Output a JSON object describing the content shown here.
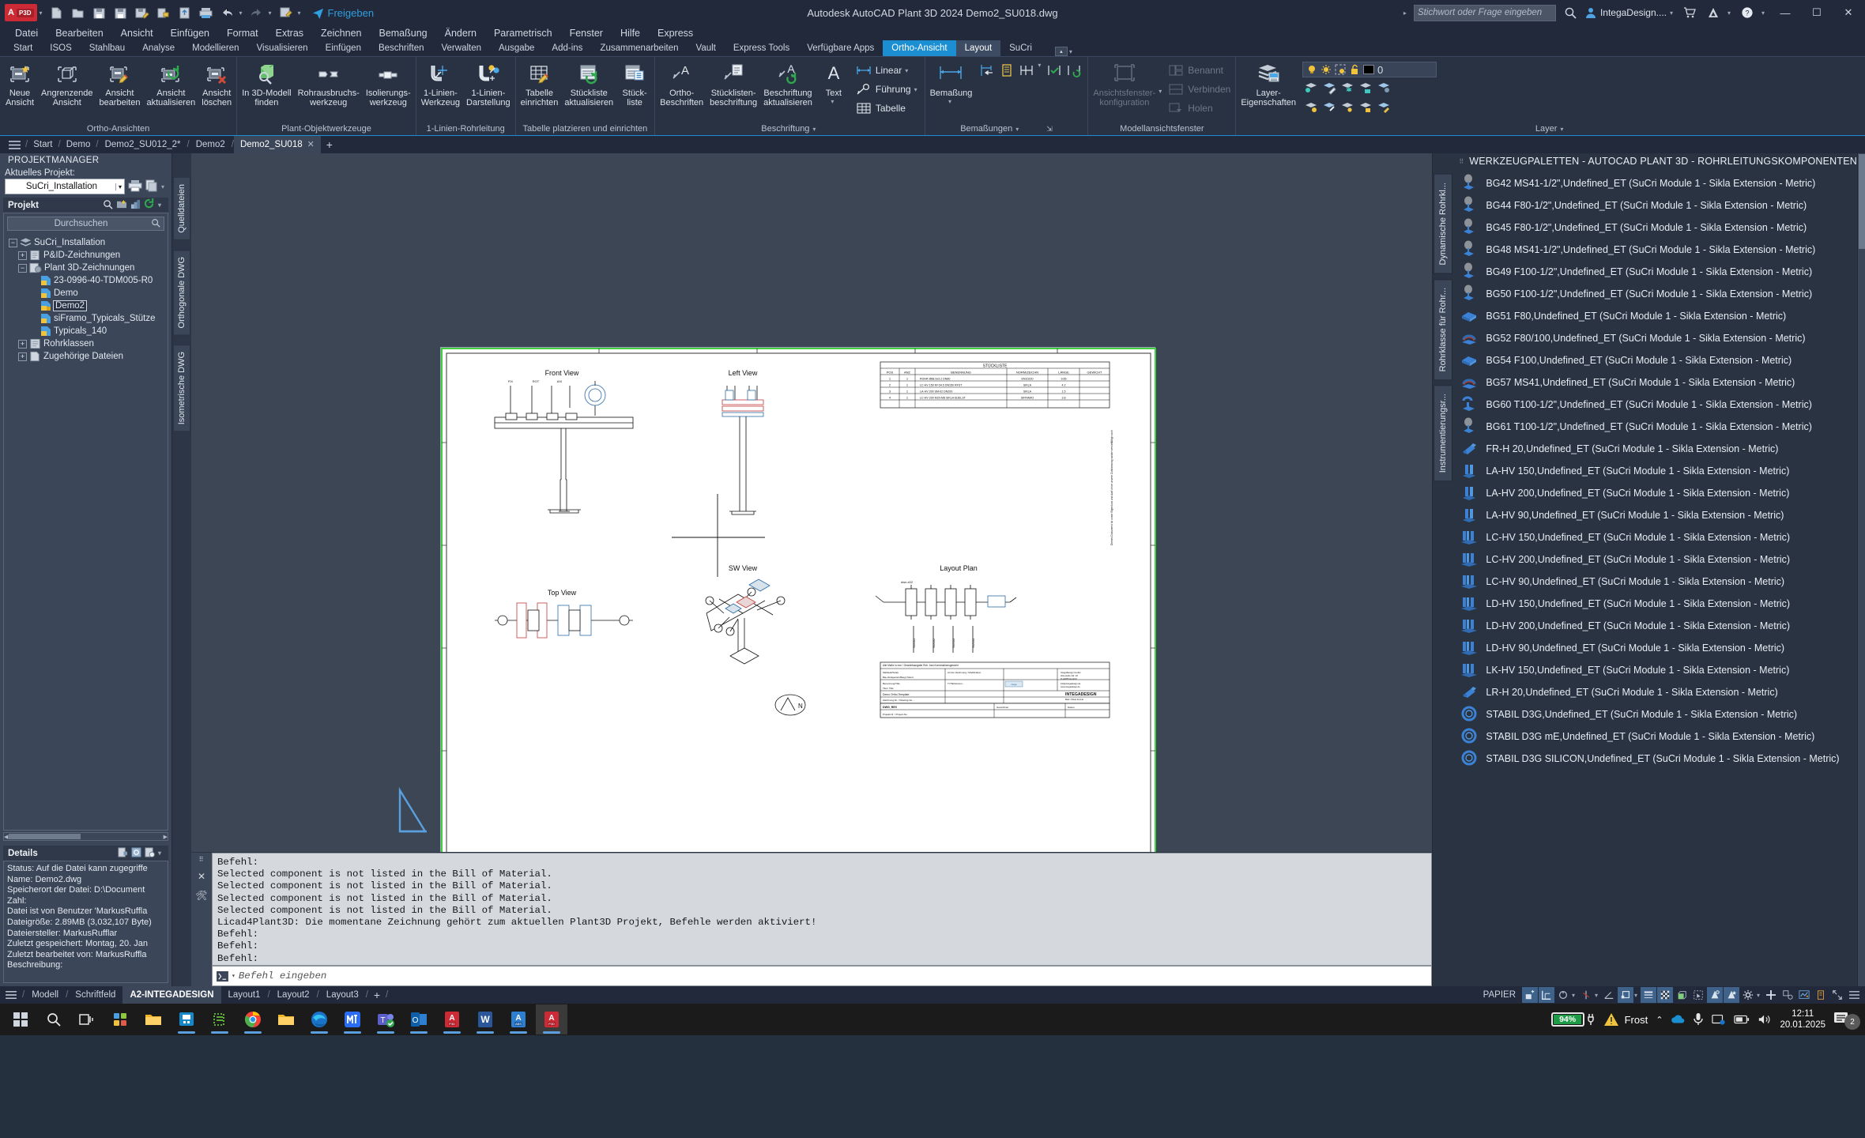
{
  "titlebar": {
    "app_name": "A",
    "app_badge": "P3D",
    "share_label": "Freigeben",
    "document_title": "Autodesk AutoCAD Plant 3D 2024    Demo2_SU018.dwg",
    "search_placeholder": "Stichwort oder Frage eingeben",
    "account_name": "IntegaDesign....",
    "quick_access": [
      "new-icon",
      "open-icon",
      "save-icon",
      "saveas-icon",
      "saveas-edit-icon",
      "export-icon",
      "share-cloud-icon",
      "plot-icon",
      "undo-icon",
      "redo-icon",
      "batch-plot-icon"
    ],
    "window_buttons": [
      "minimize",
      "restore",
      "close"
    ]
  },
  "menubar": {
    "items": [
      "Datei",
      "Bearbeiten",
      "Ansicht",
      "Einfügen",
      "Format",
      "Extras",
      "Zeichnen",
      "Bemaßung",
      "Ändern",
      "Parametrisch",
      "Fenster",
      "Hilfe",
      "Express"
    ]
  },
  "ribbon_tabs": {
    "items": [
      "Start",
      "ISOS",
      "Stahlbau",
      "Analyse",
      "Modellieren",
      "Visualisieren",
      "Einfügen",
      "Beschriften",
      "Verwalten",
      "Ausgabe",
      "Add-ins",
      "Zusammenarbeiten",
      "Vault",
      "Express Tools",
      "Verfügbare Apps",
      "Ortho-Ansicht",
      "Layout",
      "SuCri"
    ],
    "active": "Ortho-Ansicht",
    "active_secondary": "Layout"
  },
  "ribbon": {
    "panels": [
      {
        "title": "Ortho-Ansichten",
        "buttons": [
          {
            "label1": "Neue",
            "label2": "Ansicht",
            "icon": "new-view-icon"
          },
          {
            "label1": "Angrenzende",
            "label2": "Ansicht",
            "icon": "adjacent-view-icon"
          },
          {
            "label1": "Ansicht",
            "label2": "bearbeiten",
            "icon": "edit-view-icon"
          },
          {
            "label1": "Ansicht",
            "label2": "aktualisieren",
            "icon": "update-view-icon"
          },
          {
            "label1": "Ansicht",
            "label2": "löschen",
            "icon": "delete-view-icon"
          }
        ]
      },
      {
        "title": "Plant-Objektwerkzeuge",
        "buttons": [
          {
            "label1": "In 3D-Modell",
            "label2": "finden",
            "icon": "find-in-3d-icon"
          },
          {
            "label1": "Rohrausbruchs-",
            "label2": "werkzeug",
            "icon": "pipe-break-icon"
          },
          {
            "label1": "Isolierungs-",
            "label2": "werkzeug",
            "icon": "insulation-icon"
          }
        ]
      },
      {
        "title": "1-Linien-Rohrleitung",
        "buttons": [
          {
            "label1": "1-Linien-",
            "label2": "Werkzeug",
            "icon": "single-line-tool-icon"
          },
          {
            "label1": "1-Linien-",
            "label2": "Darstellung",
            "icon": "single-line-display-icon"
          }
        ]
      },
      {
        "title": "Tabelle platzieren und einrichten",
        "buttons": [
          {
            "label1": "Tabelle",
            "label2": "einrichten",
            "icon": "table-setup-icon"
          },
          {
            "label1": "Stückliste",
            "label2": "aktualisieren",
            "icon": "bom-update-icon"
          },
          {
            "label1": "Stück-",
            "label2": "liste",
            "icon": "bom-icon"
          }
        ]
      },
      {
        "title": "Beschriftung",
        "buttons": [
          {
            "label1": "Ortho-",
            "label2": "Beschriften",
            "icon": "ortho-annotate-icon"
          },
          {
            "label1": "Stücklisten-",
            "label2": "beschriftung",
            "icon": "bom-annotate-icon"
          },
          {
            "label1": "Beschriftung",
            "label2": "aktualisieren",
            "icon": "annotate-update-icon"
          },
          {
            "label1": "Text",
            "label2": "",
            "icon": "text-icon"
          }
        ],
        "small_buttons": [
          "Linear",
          "Führung",
          "Tabelle"
        ]
      },
      {
        "title": "Bemaßungen",
        "buttons": [
          {
            "label1": "Bemaßung",
            "label2": "",
            "icon": "dimension-icon"
          }
        ],
        "tools": [
          "dim-baseline-icon",
          "dim-continue-icon",
          "dim-space-icon",
          "dim-check-icon",
          "dim-update-icon"
        ]
      },
      {
        "title": "Modellansichtsfenster",
        "buttons": [
          {
            "label1": "Ansichtsfenster-",
            "label2": "konfiguration",
            "icon": "viewport-config-icon",
            "dim": true
          }
        ],
        "small_buttons": [
          {
            "label": "Benannt",
            "icon": "named-viewport-icon",
            "dim": true
          },
          {
            "label": "Verbinden",
            "icon": "join-viewport-icon",
            "dim": true
          },
          {
            "label": "Holen",
            "icon": "restore-viewport-icon",
            "dim": true
          }
        ]
      },
      {
        "title": "Layer",
        "buttons": [
          {
            "label1": "Layer-",
            "label2": "Eigenschaften",
            "icon": "layer-properties-icon"
          }
        ],
        "layer_state": {
          "value": "0",
          "color": "#000000",
          "icons": [
            "bulb-icon",
            "sun-icon",
            "freeze-icon",
            "unlock-icon"
          ]
        },
        "actions": [
          "Abgleichen",
          "Layer"
        ]
      }
    ]
  },
  "filetabs": {
    "breadcrumbs": [
      "Start",
      "Demo"
    ],
    "tabs": [
      {
        "label": "Demo2_SU012_2*",
        "active": false
      },
      {
        "label": "Demo2",
        "active": false
      },
      {
        "label": "Demo2_SU018",
        "active": true,
        "closable": true
      }
    ],
    "add_label": "+"
  },
  "project_manager": {
    "header": "PROJEKTMANAGER",
    "current_project_label": "Aktuelles Projekt:",
    "current_project": "SuCri_Installation",
    "section_title": "Projekt",
    "search_placeholder": "Durchsuchen",
    "tree": [
      {
        "label": "SuCri_Installation",
        "depth": 0,
        "expander": "-",
        "icon": "project-icon"
      },
      {
        "label": "P&ID-Zeichnungen",
        "depth": 1,
        "expander": "+",
        "icon": "pid-folder-icon"
      },
      {
        "label": "Plant 3D-Zeichnungen",
        "depth": 1,
        "expander": "-",
        "icon": "plant3d-folder-icon"
      },
      {
        "label": "23-0996-40-TDM005-R0",
        "depth": 2,
        "expander": "",
        "icon": "dwg-icon"
      },
      {
        "label": "Demo",
        "depth": 2,
        "expander": "",
        "icon": "dwg-icon"
      },
      {
        "label": "Demo2",
        "depth": 2,
        "expander": "",
        "icon": "dwg-lock-icon",
        "selected": true
      },
      {
        "label": "siFramo_Typicals_Stütze",
        "depth": 2,
        "expander": "",
        "icon": "dwg-icon"
      },
      {
        "label": "Typicals_140",
        "depth": 2,
        "expander": "",
        "icon": "dwg-icon"
      },
      {
        "label": "Rohrklassen",
        "depth": 1,
        "expander": "+",
        "icon": "specs-icon"
      },
      {
        "label": "Zugehörige Dateien",
        "depth": 1,
        "expander": "+",
        "icon": "files-icon"
      }
    ],
    "vertical_tabs": [
      "Quelldateien",
      "Orthogonale DWG",
      "Isometrische DWG"
    ],
    "details": {
      "title": "Details",
      "lines": [
        "Status: Auf die Datei kann zugegriffe",
        "Name:  Demo2.dwg",
        "Speicherort der Datei:  D:\\Document",
        "Zahl:",
        "Datei ist von Benutzer 'MarkusRuffla",
        "Dateigröße: 2.89MB (3,032,107 Byte)",
        "Dateiersteller:  MarkusRufflar",
        "Zuletzt gespeichert: Montag, 20. Jan",
        "Zuletzt bearbeitet von: MarkusRuffla",
        "Beschreibung:"
      ]
    }
  },
  "drawing": {
    "views": [
      {
        "label": "Front View"
      },
      {
        "label": "Left View"
      },
      {
        "label": "Top View"
      },
      {
        "label": "SW View"
      },
      {
        "label": "Layout Plan"
      }
    ],
    "bom_title": "STÜCKLISTE",
    "bom_headers": [
      "POS",
      "ANZ",
      "BENENNUNG",
      "NORM/ZEICHN",
      "LÄNGE",
      "GEWICHT"
    ],
    "bom_rows": [
      [
        "1",
        "1",
        "ROHR Ø88.9x3.2  DN80",
        "EN10220",
        "9.65",
        ""
      ],
      [
        "2",
        "1",
        "LC-HV 150  M=34.5 DN150 RFST",
        "SIKLA",
        "4.2",
        ""
      ],
      [
        "3",
        "1",
        "LA-HV 200  SM-02 DN200",
        "SIKLA",
        "1.5",
        ""
      ],
      [
        "4",
        "1",
        "LC-HV 200  M20-M8 SIKLA EDELSTAHL",
        "SIFRAMO",
        "3.8",
        ""
      ]
    ],
    "north_label": "N",
    "title_block": {
      "company": "INTEGADESIGN",
      "project": "Demo Ortho-Template"
    }
  },
  "commandline": {
    "history": [
      "Befehl:",
      "Selected component is not listed in the Bill of Material.",
      "Selected component is not listed in the Bill of Material.",
      "Selected component is not listed in the Bill of Material.",
      "Selected component is not listed in the Bill of Material.",
      "Licad4Plant3D: Die momentane Zeichnung gehört zum aktuellen Plant3D Projekt, Befehle werden aktiviert!",
      "Befehl:",
      "Befehl:",
      "Befehl:"
    ],
    "input_placeholder": "Befehl eingeben"
  },
  "palette": {
    "title": "WERKZEUGPALETTEN - AUTOCAD PLANT 3D - ROHRLEITUNGSKOMPONENTEN",
    "vertical_tabs": [
      "Dynamische Rohrkl...",
      "Rohrklasse für Rohr...",
      "Instrumentierungsr..."
    ],
    "items": [
      {
        "label": "BG42 MS41-1/2\",Undefined_ET (SuCri Module 1 - Sikla Extension - Metric)",
        "icon": "clamp-icon"
      },
      {
        "label": "BG44 F80-1/2\",Undefined_ET (SuCri Module 1 - Sikla Extension - Metric)",
        "icon": "clamp-icon"
      },
      {
        "label": "BG45 F80-1/2\",Undefined_ET (SuCri Module 1 - Sikla Extension - Metric)",
        "icon": "clamp-icon"
      },
      {
        "label": "BG48 MS41-1/2\",Undefined_ET (SuCri Module 1 - Sikla Extension - Metric)",
        "icon": "clamp-icon"
      },
      {
        "label": "BG49 F100-1/2\",Undefined_ET (SuCri Module 1 - Sikla Extension - Metric)",
        "icon": "clamp-icon"
      },
      {
        "label": "BG50 F100-1/2\",Undefined_ET (SuCri Module 1 - Sikla Extension - Metric)",
        "icon": "clamp-icon"
      },
      {
        "label": "BG51 F80,Undefined_ET (SuCri Module 1 - Sikla Extension - Metric)",
        "icon": "plate-icon"
      },
      {
        "label": "BG52 F80/100,Undefined_ET (SuCri Module 1 - Sikla Extension - Metric)",
        "icon": "saddle-icon"
      },
      {
        "label": "BG54 F100,Undefined_ET (SuCri Module 1 - Sikla Extension - Metric)",
        "icon": "plate-icon"
      },
      {
        "label": "BG57 MS41,Undefined_ET (SuCri Module 1 - Sikla Extension - Metric)",
        "icon": "saddle-icon"
      },
      {
        "label": "BG60 T100-1/2\",Undefined_ET (SuCri Module 1 - Sikla Extension - Metric)",
        "icon": "tee-clamp-icon"
      },
      {
        "label": "BG61 T100-1/2\",Undefined_ET (SuCri Module 1 - Sikla Extension - Metric)",
        "icon": "clamp-icon"
      },
      {
        "label": "FR-H 20,Undefined_ET (SuCri Module 1 - Sikla Extension - Metric)",
        "icon": "bracket-icon"
      },
      {
        "label": "LA-HV 150,Undefined_ET (SuCri Module 1 - Sikla Extension - Metric)",
        "icon": "support-icon"
      },
      {
        "label": "LA-HV 200,Undefined_ET (SuCri Module 1 - Sikla Extension - Metric)",
        "icon": "support-icon"
      },
      {
        "label": "LA-HV 90,Undefined_ET (SuCri Module 1 - Sikla Extension - Metric)",
        "icon": "support-icon"
      },
      {
        "label": "LC-HV 150,Undefined_ET (SuCri Module 1 - Sikla Extension - Metric)",
        "icon": "double-support-icon"
      },
      {
        "label": "LC-HV 200,Undefined_ET (SuCri Module 1 - Sikla Extension - Metric)",
        "icon": "double-support-icon"
      },
      {
        "label": "LC-HV 90,Undefined_ET (SuCri Module 1 - Sikla Extension - Metric)",
        "icon": "double-support-icon"
      },
      {
        "label": "LD-HV 150,Undefined_ET (SuCri Module 1 - Sikla Extension - Metric)",
        "icon": "double-support-icon"
      },
      {
        "label": "LD-HV 200,Undefined_ET (SuCri Module 1 - Sikla Extension - Metric)",
        "icon": "double-support-icon"
      },
      {
        "label": "LD-HV 90,Undefined_ET (SuCri Module 1 - Sikla Extension - Metric)",
        "icon": "double-support-icon"
      },
      {
        "label": "LK-HV 150,Undefined_ET (SuCri Module 1 - Sikla Extension - Metric)",
        "icon": "double-support-icon"
      },
      {
        "label": "LR-H 20,Undefined_ET (SuCri Module 1 - Sikla Extension - Metric)",
        "icon": "bracket-icon"
      },
      {
        "label": "STABIL D3G,Undefined_ET (SuCri Module 1 - Sikla Extension - Metric)",
        "icon": "ring-icon"
      },
      {
        "label": "STABIL D3G mE,Undefined_ET (SuCri Module 1 - Sikla Extension - Metric)",
        "icon": "ring-icon"
      },
      {
        "label": "STABIL D3G SILICON,Undefined_ET (SuCri Module 1 - Sikla Extension - Metric)",
        "icon": "ring-icon"
      }
    ]
  },
  "statusbar": {
    "layout_tabs": [
      "Modell",
      "Schriftfeld",
      "A2-INTEGADESIGN",
      "Layout1",
      "Layout2",
      "Layout3"
    ],
    "active_layout": "A2-INTEGADESIGN",
    "add_label": "+",
    "space_label": "PAPIER"
  },
  "taskbar": {
    "apps": [
      "start-icon",
      "search-icon",
      "taskview-icon",
      "widgets-icon",
      "explorer-icon",
      "licad-icon",
      "cad-green-icon",
      "chrome-icon",
      "folder-icon",
      "edge-icon",
      "m-icon",
      "teams-icon",
      "outlook-icon",
      "autocad-p3d-icon",
      "word-icon",
      "autocad-abs-icon",
      "autocad-p3d-active-icon"
    ],
    "battery_percent": "94%",
    "weather": "Frost",
    "time": "12:11",
    "date": "20.01.2025",
    "notification_count": "2"
  }
}
